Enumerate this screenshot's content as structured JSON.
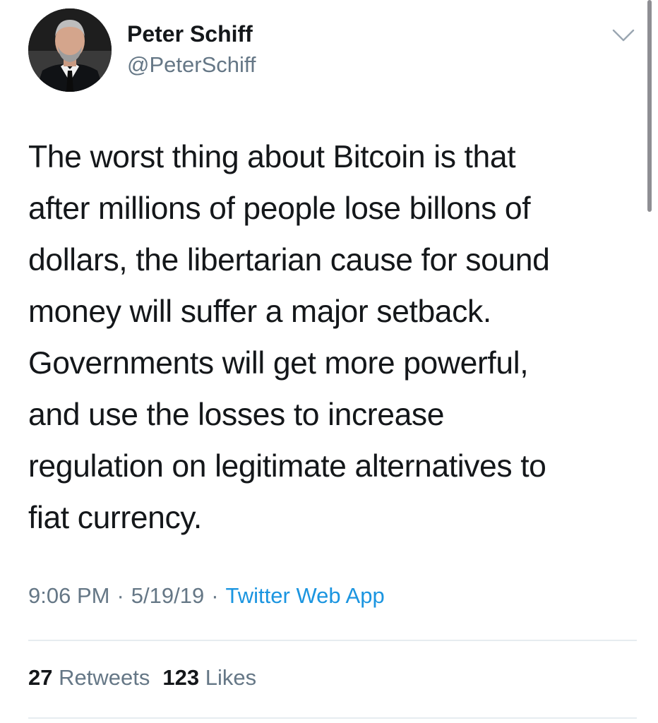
{
  "author": {
    "name": "Peter Schiff",
    "handle": "@PeterSchiff",
    "avatar_icon": "profile-photo"
  },
  "menu": {
    "icon": "chevron-down-icon"
  },
  "tweet": {
    "text": "The worst thing about Bitcoin is that\nafter millions of people lose billons of\ndollars, the libertarian cause for sound\nmoney will suffer a major setback.\nGovernments will get more powerful,\nand use the losses to increase\nregulation on legitimate alternatives to\nfiat currency.",
    "time": "9:06 PM",
    "separator": "·",
    "date": "5/19/19",
    "source": "Twitter Web App"
  },
  "stats": {
    "retweets_count": "27",
    "retweets_label": "Retweets",
    "likes_count": "123",
    "likes_label": "Likes"
  },
  "colors": {
    "text": "#14171a",
    "secondary": "#657786",
    "link": "#1b95e0",
    "divider": "#e6ecf0"
  }
}
